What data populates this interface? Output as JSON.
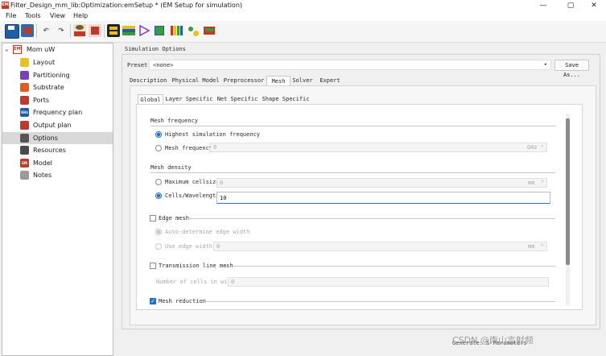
{
  "window": {
    "app_icon_text": "EM",
    "title": "Filter_Design_mm_lib:Optimization:emSetup * (EM Setup for simulation)",
    "minimize": "—",
    "maximize": "▢",
    "close": "✕"
  },
  "menu": [
    "File",
    "Tools",
    "View",
    "Help"
  ],
  "toolbar": {
    "icons": [
      "save-icon",
      "em-save-icon",
      "undo-icon",
      "redo-icon",
      "em-settings-icon",
      "em-delete-icon",
      "layout-icon",
      "substrate-icon",
      "simulate-icon",
      "view-3d-icon",
      "palette-icon",
      "components-icon",
      "substrate-3d-icon"
    ],
    "colors": {
      "blue": "#1f5fa8",
      "red": "#c0392b",
      "yellow": "#e8c21a",
      "green": "#3a9b3a",
      "purple": "#7b3fbf"
    }
  },
  "tree": {
    "root": "Mom uW",
    "root_icon": "EM",
    "items": [
      {
        "label": "Layout",
        "icon": "layout-icon",
        "color": "#e8c21a"
      },
      {
        "label": "Partitioning",
        "icon": "partitioning-icon",
        "color": "#7b3fbf"
      },
      {
        "label": "Substrate",
        "icon": "substrate-icon",
        "color": "#e85a1a"
      },
      {
        "label": "Ports",
        "icon": "ports-icon",
        "color": "#c0392b"
      },
      {
        "label": "Frequency plan",
        "icon": "frequency-plan-icon",
        "color": "#1f5fa8",
        "text": "GHz"
      },
      {
        "label": "Output plan",
        "icon": "output-plan-icon",
        "color": "#c0392b"
      },
      {
        "label": "Options",
        "icon": "options-icon",
        "color": "#555555",
        "selected": true
      },
      {
        "label": "Resources",
        "icon": "resources-icon",
        "color": "#4a4a4a"
      },
      {
        "label": "Model",
        "icon": "model-icon",
        "color": "#c0392b",
        "text": "EM"
      },
      {
        "label": "Notes",
        "icon": "notes-icon",
        "color": "#9a9a9a"
      }
    ]
  },
  "simulation_options": {
    "group_title": "Simulation Options",
    "preset_label": "Preset:",
    "preset_value": "<none>",
    "save_as": "Save As...",
    "tabs": [
      "Description",
      "Physical Model",
      "Preprocessor",
      "Mesh",
      "Solver",
      "Expert"
    ],
    "active_tab": "Mesh",
    "subtabs": [
      "Global",
      "Layer Specific",
      "Net Specific",
      "Shape Specific"
    ],
    "active_subtab": "Global"
  },
  "mesh": {
    "frequency_section": "Mesh frequency",
    "highest_freq": "Highest simulation frequency",
    "mesh_freq": "Mesh frequency",
    "mesh_freq_value": "0",
    "mesh_freq_unit": "GHz",
    "density_section": "Mesh density",
    "max_cellsize": "Maximum cellsize",
    "max_cellsize_value": "0",
    "max_cellsize_unit": "mm",
    "cells_wavelength": "Cells/Wavelength",
    "cells_wavelength_value": "10",
    "edge_mesh": "Edge mesh",
    "auto_edge": "Auto-determine edge width",
    "use_edge": "Use edge width",
    "use_edge_value": "0",
    "use_edge_unit": "mm",
    "tline_mesh": "Transmission line mesh",
    "cells_in_width": "Number of cells in width",
    "cells_in_width_value": "0",
    "mesh_reduction": "Mesh reduction"
  },
  "footer": {
    "generate": "Generate: S-Parameters",
    "watermark": "CSDN @南山言射频"
  }
}
